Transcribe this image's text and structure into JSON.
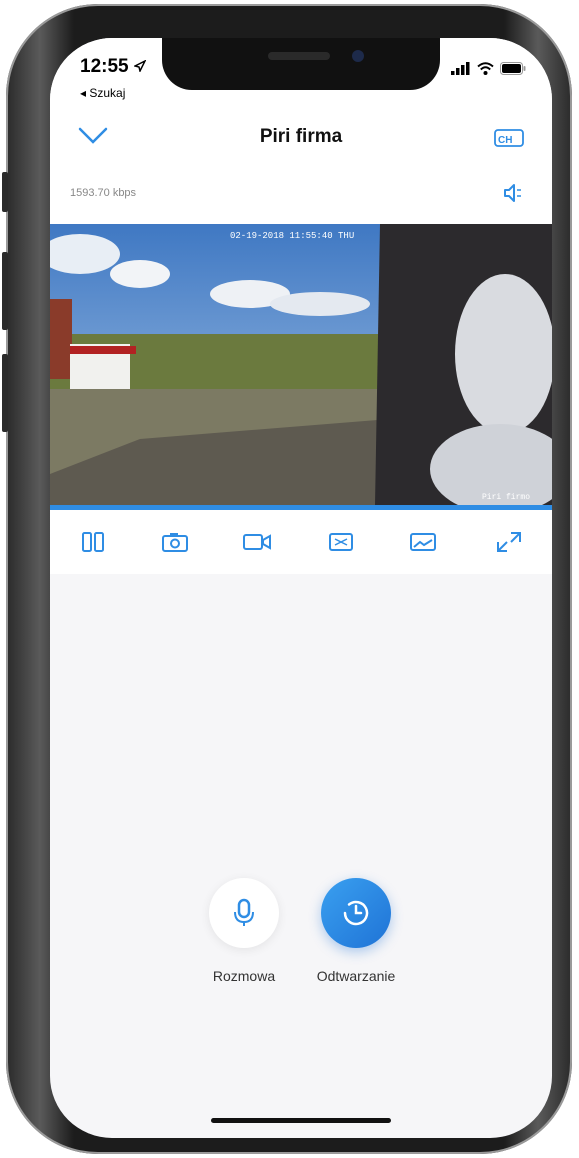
{
  "status_bar": {
    "time": "12:55",
    "back_label": "◂ Szukaj"
  },
  "header": {
    "title": "Piri firma",
    "bitrate": "1593.70 kbps",
    "channel_label": "CH"
  },
  "video": {
    "timestamp_overlay": "02-19-2018 11:55:40 THU",
    "camera_overlay": "Piri firmo"
  },
  "actions": [
    {
      "label": "Rozmowa",
      "icon": "microphone-icon"
    },
    {
      "label": "Odtwarzanie",
      "icon": "clock-playback-icon"
    }
  ],
  "colors": {
    "accent": "#2f8de4",
    "background": "#f6f6f8"
  }
}
